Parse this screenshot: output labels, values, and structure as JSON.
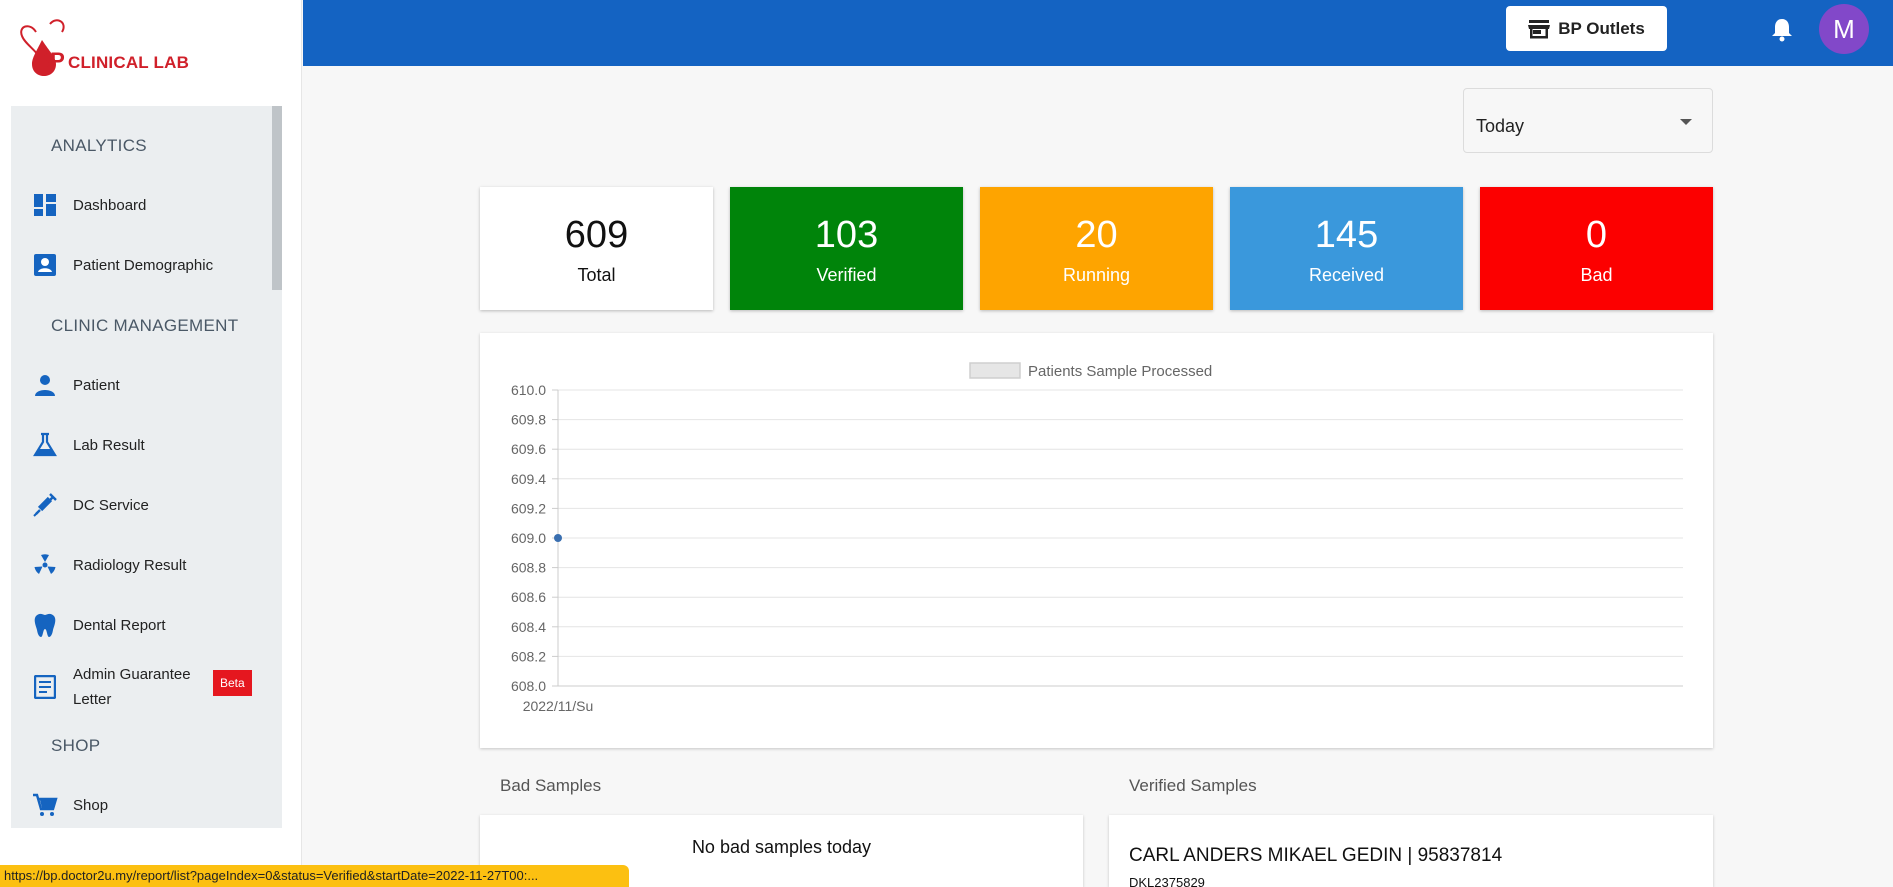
{
  "brand": {
    "logo_bp": "BP",
    "logo_text": "CLINICAL LAB",
    "color": "#d0202a"
  },
  "sidebar": {
    "sections": [
      {
        "label": "ANALYTICS"
      },
      {
        "label": "CLINIC MANAGEMENT"
      },
      {
        "label": "SHOP"
      }
    ],
    "items": [
      {
        "label": "Dashboard",
        "icon": "dashboard-icon"
      },
      {
        "label": "Patient Demographic",
        "icon": "contact-card-icon"
      },
      {
        "label": "Patient",
        "icon": "person-icon"
      },
      {
        "label": "Lab Result",
        "icon": "flask-icon"
      },
      {
        "label": "DC Service",
        "icon": "syringe-icon"
      },
      {
        "label": "Radiology Result",
        "icon": "radiation-icon"
      },
      {
        "label": "Dental Report",
        "icon": "tooth-icon"
      },
      {
        "label": "Admin Guarantee Letter",
        "icon": "document-icon",
        "badge": "Beta"
      },
      {
        "label": "Shop",
        "icon": "cart-icon"
      }
    ]
  },
  "header": {
    "outlets_label": "BP Outlets",
    "avatar_initial": "M",
    "bg_color": "#1463c2"
  },
  "filter": {
    "period": "Today"
  },
  "stats": [
    {
      "value": "609",
      "label": "Total",
      "color": "#ffffff"
    },
    {
      "value": "103",
      "label": "Verified",
      "color": "#00840a"
    },
    {
      "value": "20",
      "label": "Running",
      "color": "#fea400"
    },
    {
      "value": "145",
      "label": "Received",
      "color": "#3a98dc"
    },
    {
      "value": "0",
      "label": "Bad",
      "color": "#fc0000"
    }
  ],
  "chart_data": {
    "type": "line",
    "legend": "Patients Sample Processed",
    "legend_placement": "top-center",
    "categories": [
      "2022/11/Su"
    ],
    "series": [
      {
        "name": "Patients Sample Processed",
        "values": [
          609
        ]
      }
    ],
    "ylim": [
      608.0,
      610.0
    ],
    "yticks": [
      "610.0",
      "609.8",
      "609.6",
      "609.4",
      "609.2",
      "609.0",
      "608.8",
      "608.6",
      "608.4",
      "608.2",
      "608.0"
    ],
    "grid": true,
    "point_color": "#3a6fb0"
  },
  "bad_samples": {
    "title": "Bad Samples",
    "empty_message": "No bad samples today"
  },
  "verified_samples": {
    "title": "Verified Samples",
    "rows": [
      {
        "name": "CARL ANDERS MIKAEL GEDIN | 95837814",
        "sub": "DKL2375829"
      }
    ]
  },
  "status_url": "https://bp.doctor2u.my/report/list?pageIndex=0&status=Verified&startDate=2022-11-27T00:..."
}
